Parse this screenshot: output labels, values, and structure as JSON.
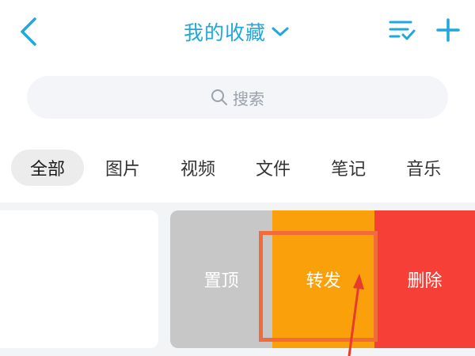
{
  "header": {
    "title": "我的收藏",
    "icons": {
      "back": "chevron-left-icon",
      "title_dropdown": "chevron-down-icon",
      "multi_select": "list-check-icon",
      "add": "plus-icon"
    }
  },
  "search": {
    "placeholder": "搜索",
    "icon": "search-icon"
  },
  "tabs": [
    {
      "label": "全部",
      "active": true
    },
    {
      "label": "图片",
      "active": false
    },
    {
      "label": "视频",
      "active": false
    },
    {
      "label": "文件",
      "active": false
    },
    {
      "label": "笔记",
      "active": false
    },
    {
      "label": "音乐",
      "active": false
    }
  ],
  "item_actions": {
    "pin": "置顶",
    "forward": "转发",
    "delete": "删除"
  },
  "colors": {
    "accent": "#1ea8dc",
    "pin": "#c7c7c7",
    "forward": "#f9a00b",
    "delete": "#f63f36",
    "highlight": "#f26c3a"
  }
}
